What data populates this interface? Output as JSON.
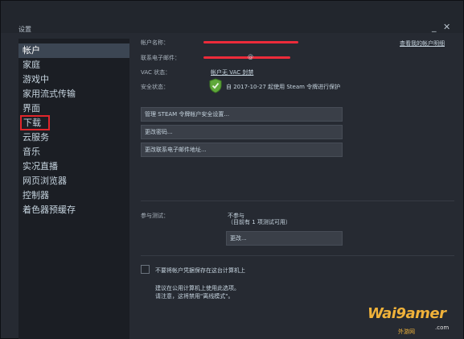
{
  "window": {
    "title": "设置",
    "minimize": "_",
    "close": "✕"
  },
  "sidebar": {
    "items": [
      {
        "label": "帐户",
        "active": true
      },
      {
        "label": "家庭"
      },
      {
        "label": "游戏中"
      },
      {
        "label": "家用流式传输"
      },
      {
        "label": "界面"
      },
      {
        "label": "下载",
        "highlighted": true
      },
      {
        "label": "云服务"
      },
      {
        "label": "音乐"
      },
      {
        "label": "实况直播"
      },
      {
        "label": "网页浏览器"
      },
      {
        "label": "控制器"
      },
      {
        "label": "着色器预缓存"
      }
    ]
  },
  "account": {
    "name_label": "帐户名称：",
    "view_details": "查看我的帐户明细",
    "email_label": "联系电子邮件：",
    "email_visible": "@",
    "vac_label": "VAC 状态：",
    "vac_value": "帐户无 VAC 封禁",
    "security_label": "安全状态：",
    "security_value": "自 2017-10-27 起使用 Steam 令牌进行保护",
    "shield_icon": "shield-check-icon",
    "buttons": {
      "manage_guard": "管理 STEAM 令牌帐户安全设置...",
      "change_password": "更改密码...",
      "change_email": "更改联系电子邮件地址..."
    }
  },
  "beta": {
    "label": "参与测试：",
    "status": "不参与",
    "sub_status": "（目前有 1 项测试可用）",
    "change_button": "更改..."
  },
  "remember": {
    "checkbox_label": "不要将帐户凭据保存在这台计算机上",
    "checked": false,
    "note_line1": "建议在公用计算机上使用此选项。",
    "note_line2": "请注意，这将禁用\"离线模式\"。"
  },
  "watermark": {
    "brand": "Wai9amer",
    "site": ".com",
    "cn": "外游网"
  },
  "colors": {
    "redaction": "#ec2b3a",
    "highlight_box": "#e0262b",
    "watermark": "#f0b23a",
    "shield": "#5fa83a"
  }
}
